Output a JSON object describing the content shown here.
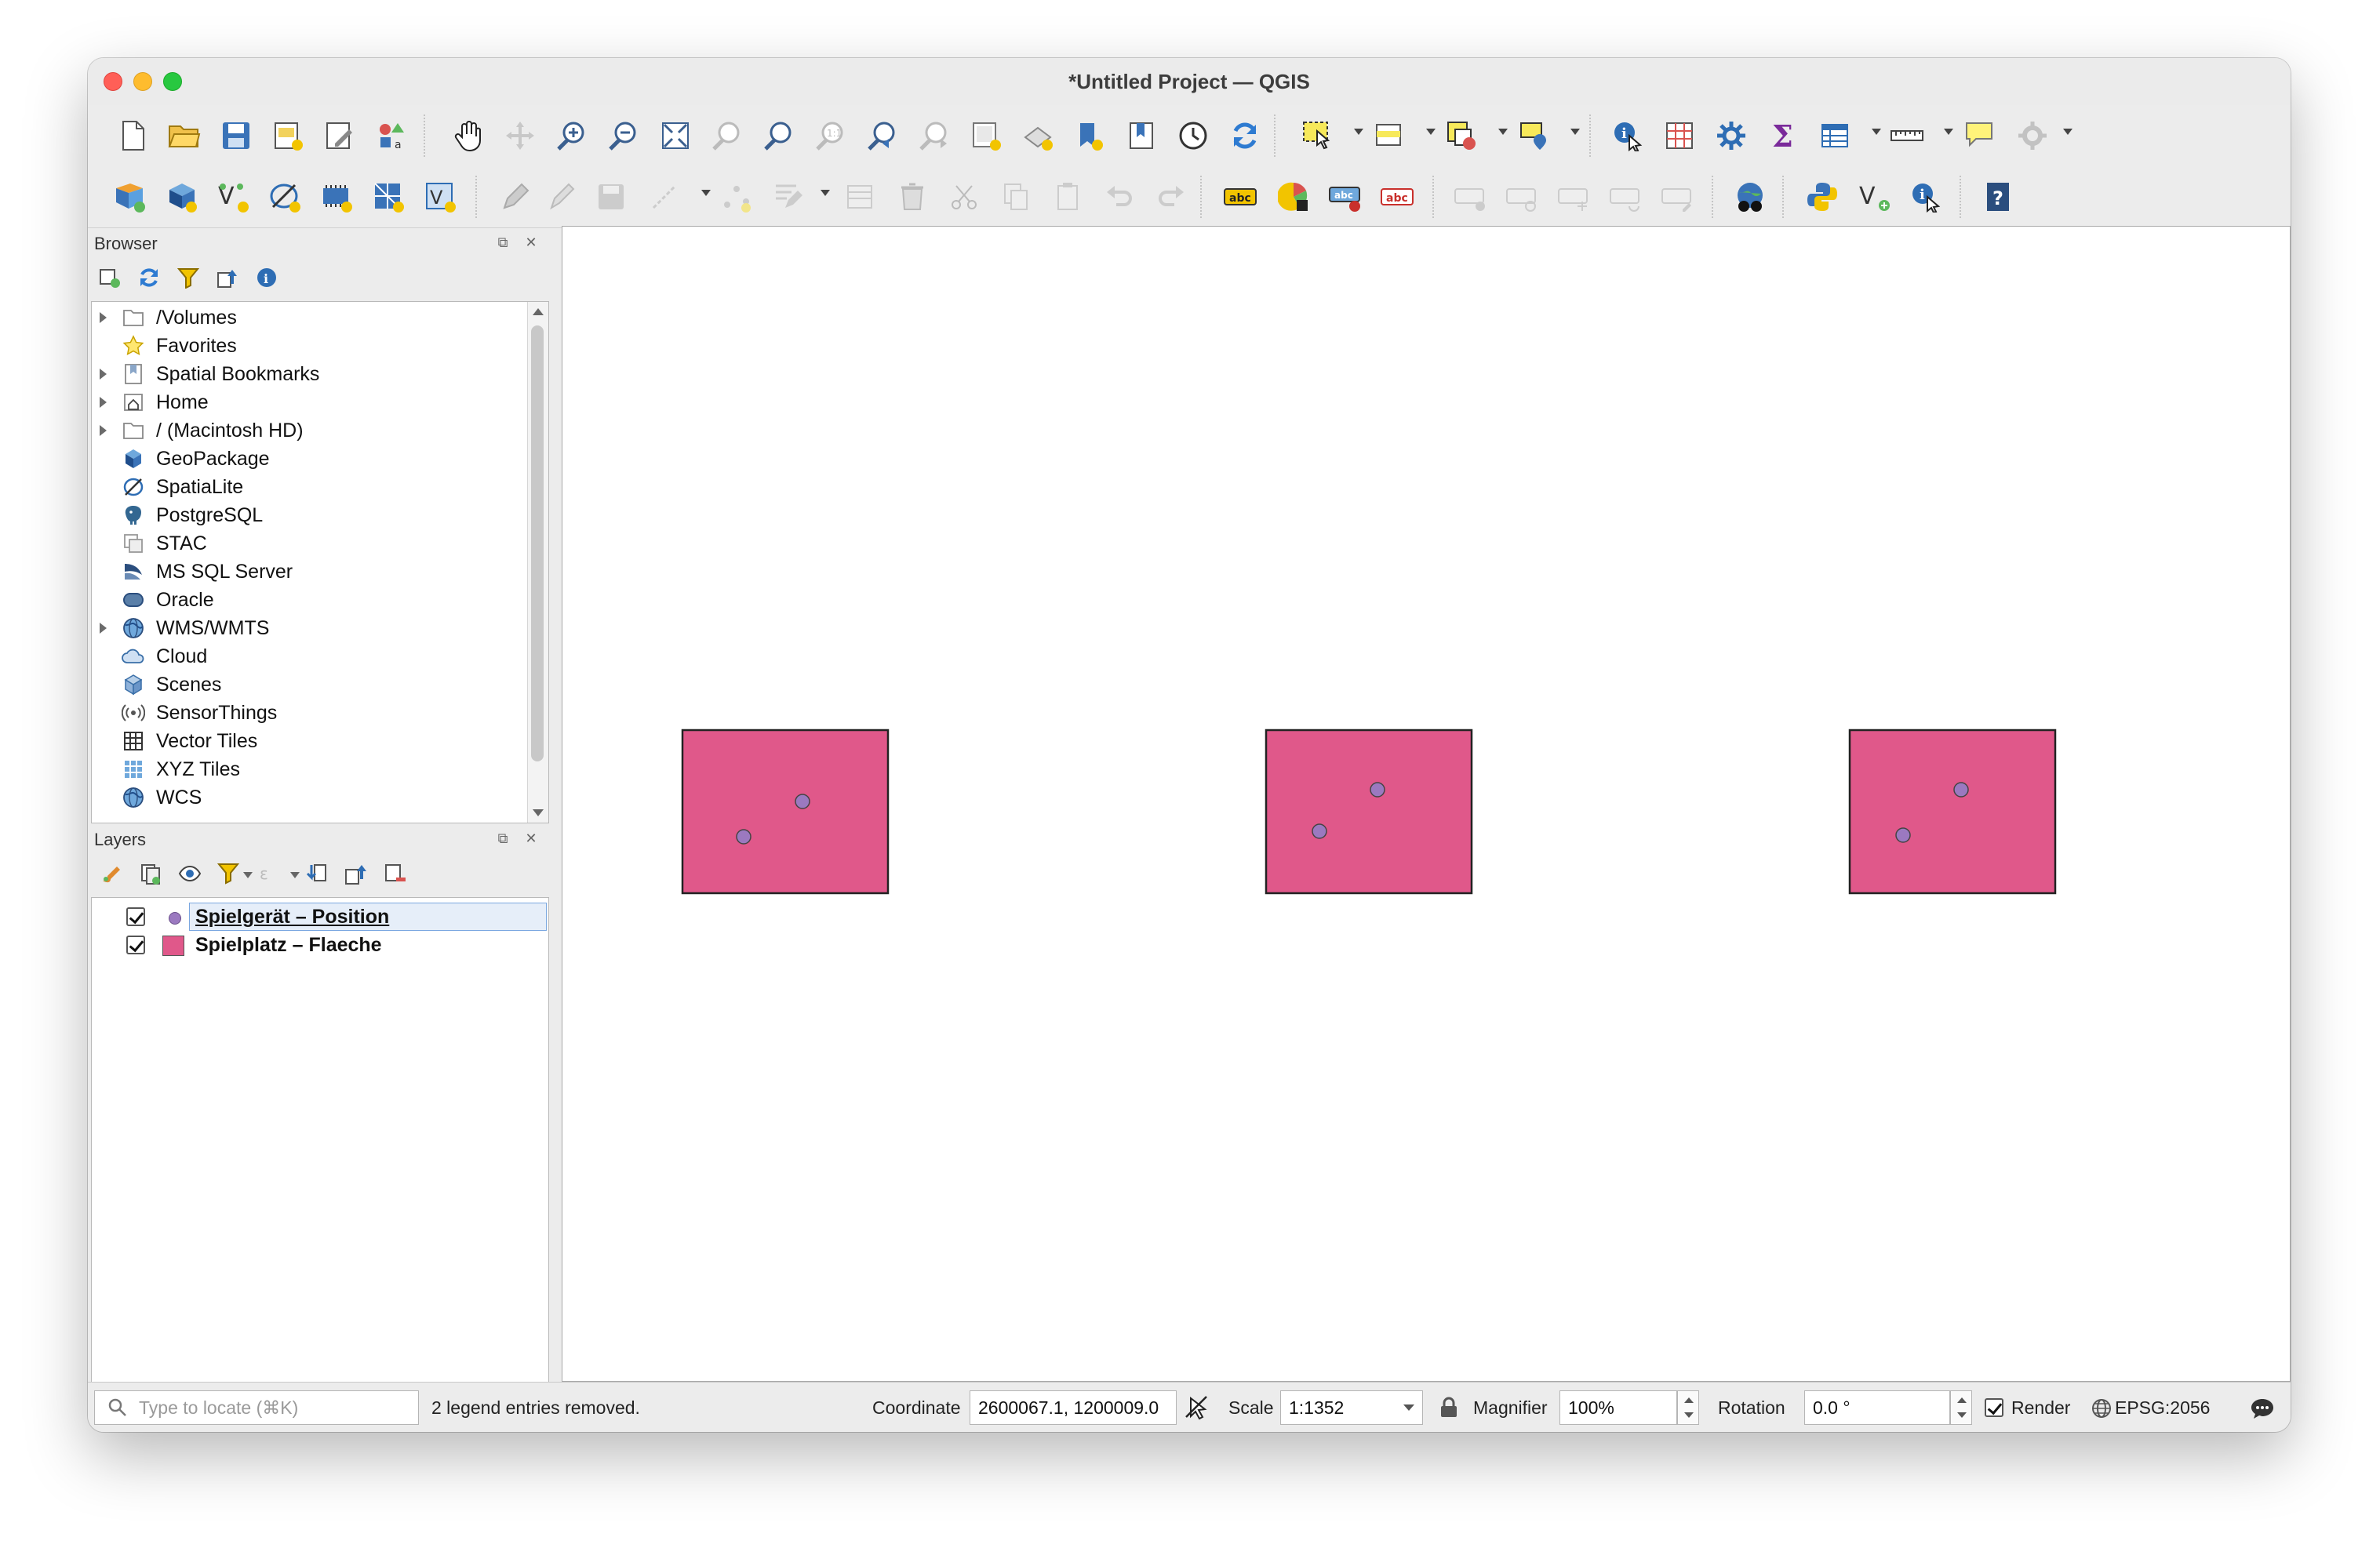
{
  "window": {
    "title": "*Untitled Project — QGIS"
  },
  "browser": {
    "title": "Browser",
    "items": [
      {
        "label": "/Volumes",
        "icon": "folder-icon",
        "expandable": true
      },
      {
        "label": "Favorites",
        "icon": "star-icon",
        "expandable": false
      },
      {
        "label": "Spatial Bookmarks",
        "icon": "bookmark-icon",
        "expandable": true
      },
      {
        "label": "Home",
        "icon": "home-icon",
        "expandable": true
      },
      {
        "label": "/ (Macintosh HD)",
        "icon": "folder-icon",
        "expandable": true
      },
      {
        "label": "GeoPackage",
        "icon": "geopackage-icon",
        "expandable": false
      },
      {
        "label": "SpatiaLite",
        "icon": "spatialite-icon",
        "expandable": false
      },
      {
        "label": "PostgreSQL",
        "icon": "postgresql-icon",
        "expandable": false
      },
      {
        "label": "STAC",
        "icon": "stac-icon",
        "expandable": false
      },
      {
        "label": "MS SQL Server",
        "icon": "mssql-icon",
        "expandable": false
      },
      {
        "label": "Oracle",
        "icon": "oracle-icon",
        "expandable": false
      },
      {
        "label": "WMS/WMTS",
        "icon": "globe-icon",
        "expandable": true
      },
      {
        "label": "Cloud",
        "icon": "cloud-icon",
        "expandable": false
      },
      {
        "label": "Scenes",
        "icon": "cube-icon",
        "expandable": false
      },
      {
        "label": "SensorThings",
        "icon": "sensor-icon",
        "expandable": false
      },
      {
        "label": "Vector Tiles",
        "icon": "grid-icon",
        "expandable": false
      },
      {
        "label": "XYZ Tiles",
        "icon": "tiles-icon",
        "expandable": false
      },
      {
        "label": "WCS",
        "icon": "globe-icon",
        "expandable": false
      }
    ]
  },
  "layers": {
    "title": "Layers",
    "items": [
      {
        "name": "Spielgerät – Position",
        "symbol": "point",
        "color": "#9b79c0",
        "checked": true,
        "selected": true
      },
      {
        "name": "Spielplatz – Flaeche",
        "symbol": "polygon",
        "color": "#e0588a",
        "checked": true,
        "selected": false
      }
    ]
  },
  "map": {
    "polygon_fill": "#e0588a",
    "point_fill": "#9b79c0"
  },
  "status": {
    "locator_placeholder": "Type to locate (⌘K)",
    "message": "2 legend entries removed.",
    "coordinate_label": "Coordinate",
    "coordinate_value": "2600067.1, 1200009.0",
    "scale_label": "Scale",
    "scale_value": "1:1352",
    "magnifier_label": "Magnifier",
    "magnifier_value": "100%",
    "rotation_label": "Rotation",
    "rotation_value": "0.0 °",
    "render_label": "Render",
    "crs_label": "EPSG:2056"
  }
}
